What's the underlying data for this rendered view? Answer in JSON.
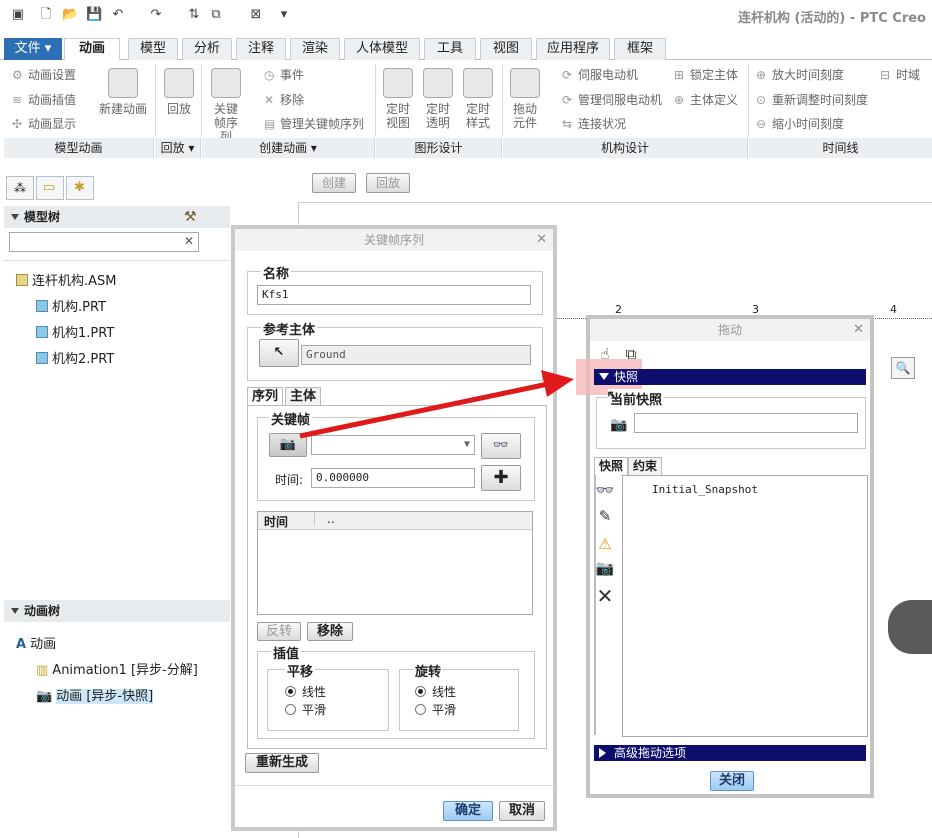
{
  "window": {
    "title": "连杆机构 (活动的) - PTC Creo"
  },
  "tabs": [
    "文件",
    "动画",
    "模型",
    "分析",
    "注释",
    "渲染",
    "人体模型",
    "工具",
    "视图",
    "应用程序",
    "框架"
  ],
  "ribbon": {
    "model_anim": {
      "items": [
        "动画设置",
        "动画插值",
        "动画显示"
      ],
      "new_anim": "新建动画",
      "label": "模型动画"
    },
    "playback": {
      "btn": "回放",
      "label": "回放"
    },
    "create": {
      "keyframe_seq": "关键帧序列",
      "event": "事件",
      "remove": "移除",
      "manage": "管理关键帧序列",
      "label": "创建动画"
    },
    "graphic": {
      "items": [
        "定时视图",
        "定时透明",
        "定时样式"
      ],
      "label": "图形设计"
    },
    "mech": {
      "drag": "拖动元件",
      "servo": "伺服电动机",
      "manage_servo": "管理伺服电动机",
      "connect": "连接状况",
      "lock": "锁定主体",
      "body_def": "主体定义",
      "label": "机构设计"
    },
    "timeline": {
      "zoom_in": "放大时间刻度",
      "rescale": "重新调整时间刻度",
      "zoom_out": "缩小时间刻度",
      "timeline": "时域",
      "label": "时间线"
    }
  },
  "canvas_buttons": {
    "create": "创建",
    "playback": "回放"
  },
  "ruler_marks": [
    "2",
    "3",
    "4"
  ],
  "model_tree": {
    "header": "模型树",
    "search_placeholder": "",
    "items": [
      "连杆机构.ASM",
      "机构.PRT",
      "机构1.PRT",
      "机构2.PRT"
    ]
  },
  "anim_tree": {
    "header": "动画树",
    "root": "动画",
    "items": [
      "Animation1 [异步-分解]",
      "动画 [异步-快照]"
    ]
  },
  "kf_dialog": {
    "title": "关键帧序列",
    "name_label": "名称",
    "name_value": "Kfs1",
    "ref_label": "参考主体",
    "ref_value": "Ground",
    "tab_seq": "序列",
    "tab_body": "主体",
    "keyframe_label": "关键帧",
    "time_label": "时间:",
    "time_value": "0.000000",
    "col_time": "时间",
    "col_dots": "..",
    "reverse": "反转",
    "remove": "移除",
    "interp_label": "插值",
    "translate_label": "平移",
    "rotate_label": "旋转",
    "linear": "线性",
    "smooth": "平滑",
    "regen": "重新生成",
    "ok": "确定",
    "cancel": "取消"
  },
  "drag_dialog": {
    "title": "拖动",
    "snapshot_bar": "快照",
    "current_snapshot": "当前快照",
    "snapshot_value": "",
    "tab_snapshot": "快照",
    "tab_constraint": "约束",
    "list_items": [
      "Initial_Snapshot"
    ],
    "advanced": "高级拖动选项",
    "close": "关闭"
  },
  "colors": {
    "navy": "#0d0d6e",
    "arrow": "#e01a1a",
    "highlight": "#f8c4c4"
  }
}
